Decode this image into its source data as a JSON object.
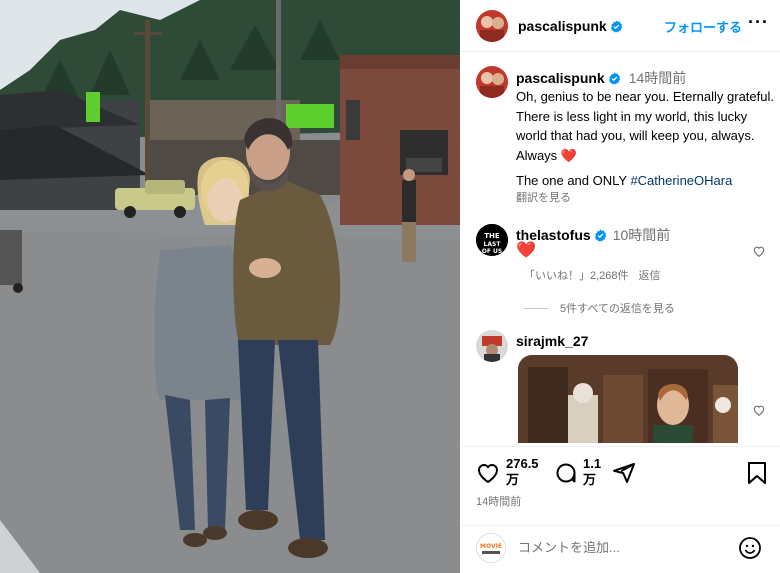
{
  "post": {
    "author": "pascalispunk",
    "follow_label": "フォローする",
    "more_label": "···",
    "caption": {
      "user": "pascalispunk",
      "time": "14時間前",
      "text": "Oh, genius to be near you. Eternally grateful.  There is less light in my world, this lucky world that had you, will keep you, always.  Always ",
      "heart": "❤️",
      "line2": "The one and ONLY ",
      "hashtag": "#CatherineOHara",
      "translate": "翻訳を見る"
    },
    "comments": [
      {
        "user": "thelastofus",
        "time": "10時間前",
        "text": "❤️",
        "likes": "「いいね！」2,268件",
        "reply": "返信",
        "view_replies": "5件すべての返信を見る"
      },
      {
        "user": "sirajmk_27"
      }
    ],
    "actions": {
      "like_count": "276.5\n万",
      "comment_count": "1.1\n万",
      "time": "14時間前"
    },
    "add_comment": {
      "placeholder": "コメントを追加...",
      "avatar_text": "MOVIE"
    }
  },
  "colors": {
    "accent": "#0095f6",
    "verified": "#0095f6",
    "heart": "#e0245e",
    "hashtag": "#00376b",
    "secondary_text": "#737373"
  }
}
